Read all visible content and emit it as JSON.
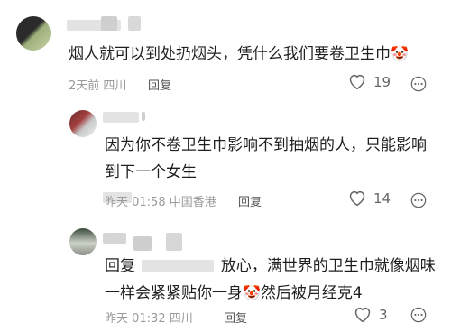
{
  "comments": [
    {
      "text": "烟人就可以到处扔烟头，凭什么我们要卷卫生巾",
      "emoji": "🤡",
      "time": "2天前",
      "location": "四川",
      "reply_label": "回复",
      "likes": "19"
    },
    {
      "line1": "因为你不卷卫生巾影响不到抽烟的人，只能影响",
      "line2": "到下一个女生",
      "time": "昨天 01:58",
      "location": "中国香港",
      "reply_label": "回复",
      "likes": "14"
    },
    {
      "reply_prefix": "回复",
      "line1": "放心，满世界的卫生巾就像烟味",
      "line2_a": "一样会紧紧贴你一身",
      "emoji": "🤡",
      "line2_b": "然后被月经克4",
      "time": "昨天 01:32",
      "location": "四川",
      "reply_label": "回复",
      "likes": "3"
    }
  ],
  "icons": {
    "like": "heart-outline-icon",
    "more": "ellipsis-circle-icon"
  },
  "colors": {
    "text": "#1f1f1f",
    "meta": "#9a9a9a",
    "icon": "#666666"
  }
}
